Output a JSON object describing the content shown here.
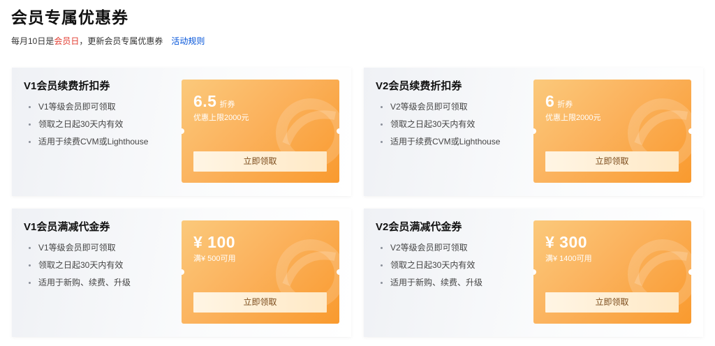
{
  "page": {
    "title": "会员专属优惠券",
    "subtitle_prefix": "每月10日是",
    "subtitle_highlight": "会员日",
    "subtitle_suffix": "，更新会员专属优惠券",
    "rules_link": "活动规则"
  },
  "colors": {
    "accent_orange": "#f99a2e",
    "highlight_red": "#e23b2f",
    "link_blue": "#0052d9"
  },
  "cards": [
    {
      "title": "V1会员续费折扣券",
      "features": [
        "V1等级会员即可领取",
        "领取之日起30天内有效",
        "适用于续费CVM或Lighthouse"
      ],
      "coupon": {
        "value": "6.5",
        "unit": "折券",
        "limit": "优惠上限2000元"
      },
      "button_label": "立即领取"
    },
    {
      "title": "V2会员续费折扣券",
      "features": [
        "V2等级会员即可领取",
        "领取之日起30天内有效",
        "适用于续费CVM或Lighthouse"
      ],
      "coupon": {
        "value": "6",
        "unit": "折券",
        "limit": "优惠上限2000元"
      },
      "button_label": "立即领取"
    },
    {
      "title": "V1会员满减代金券",
      "features": [
        "V1等级会员即可领取",
        "领取之日起30天内有效",
        "适用于新购、续费、升级"
      ],
      "coupon": {
        "value": "¥ 100",
        "unit": "",
        "limit": "满¥ 500可用"
      },
      "button_label": "立即领取"
    },
    {
      "title": "V2会员满减代金券",
      "features": [
        "V2等级会员即可领取",
        "领取之日起30天内有效",
        "适用于新购、续费、升级"
      ],
      "coupon": {
        "value": "¥ 300",
        "unit": "",
        "limit": "满¥ 1400可用"
      },
      "button_label": "立即领取"
    }
  ]
}
